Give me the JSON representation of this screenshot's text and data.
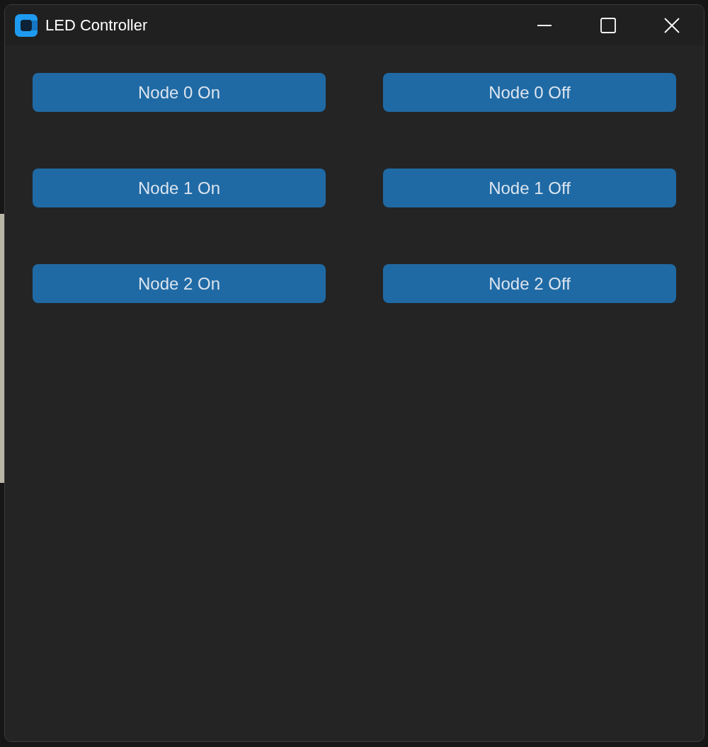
{
  "window": {
    "title": "LED Controller"
  },
  "buttons": [
    {
      "label": "Node 0 On"
    },
    {
      "label": "Node 0 Off"
    },
    {
      "label": "Node 1 On"
    },
    {
      "label": "Node 1 Off"
    },
    {
      "label": "Node 2 On"
    },
    {
      "label": "Node 2 Off"
    }
  ]
}
